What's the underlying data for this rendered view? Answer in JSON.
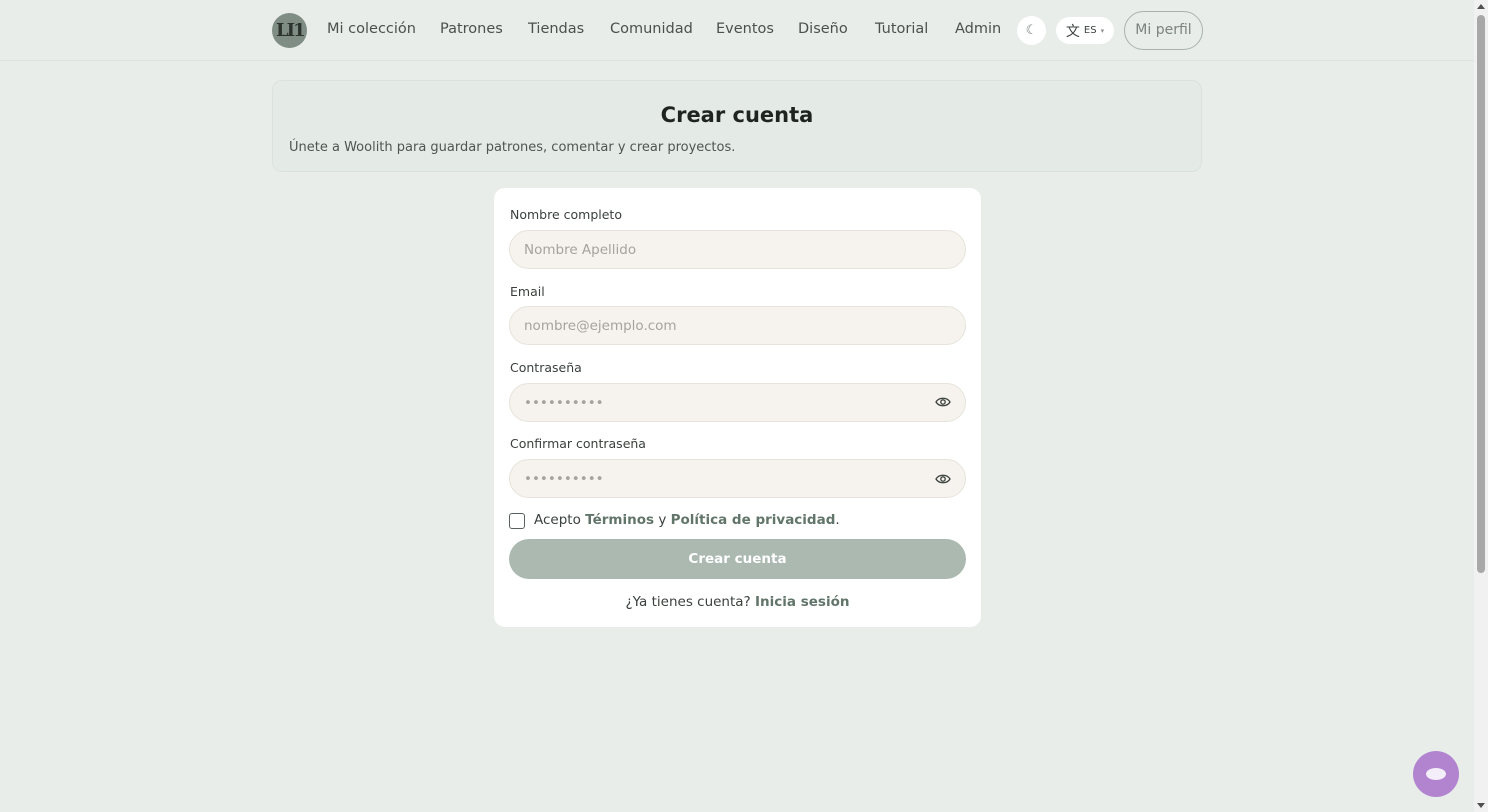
{
  "nav": {
    "items": [
      {
        "label": "Mi colección"
      },
      {
        "label": "Patrones"
      },
      {
        "label": "Tiendas"
      },
      {
        "label": "Comunidad"
      },
      {
        "label": "Eventos"
      },
      {
        "label": "Diseño"
      },
      {
        "label": "Tutorial"
      },
      {
        "label": "Admin"
      }
    ],
    "theme_icon": "☾",
    "lang_icon": "文",
    "lang_label": "ES",
    "profile_label": "Mi perfil"
  },
  "hero": {
    "title": "Crear cuenta",
    "subtitle": "Únete a Woolith para guardar patrones, comentar y crear proyectos."
  },
  "form": {
    "name_label": "Nombre completo",
    "name_placeholder": "Nombre Apellido",
    "email_label": "Email",
    "email_placeholder": "nombre@ejemplo.com",
    "password_label": "Contraseña",
    "password_placeholder": "••••••••••",
    "confirm_label": "Confirmar contraseña",
    "confirm_placeholder": "••••••••••",
    "terms_prefix": "Acepto",
    "terms_link": "Términos",
    "terms_and": "y",
    "privacy_link": "Política de privacidad",
    "terms_suffix": ".",
    "submit_label": "Crear cuenta",
    "login_prompt": "¿Ya tienes cuenta?",
    "login_link": "Inicia sesión"
  },
  "colors": {
    "background": "#e8ede9",
    "accent": "#62756a",
    "button_disabled": "#abb9b1",
    "chat_bubble": "#b284d0"
  }
}
